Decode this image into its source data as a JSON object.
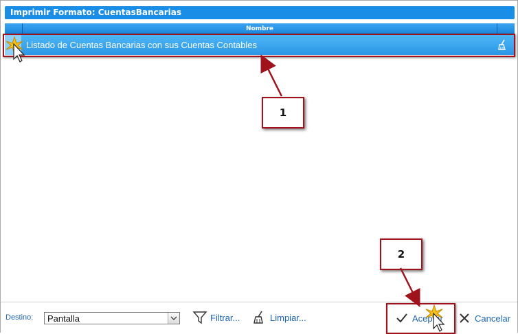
{
  "dialog": {
    "title": "Imprimir Formato: CuentasBancarias"
  },
  "grid": {
    "column_header": "Nombre",
    "rows": [
      {
        "name": "Listado de Cuentas Bancarias con sus Cuentas Contables"
      }
    ]
  },
  "callouts": {
    "first": "1",
    "second": "2"
  },
  "bottom_bar": {
    "destination_label": "Destino:",
    "destination_value": "Pantalla",
    "filter_label": "Filtrar...",
    "clear_label": "Limpiar...",
    "accept_label": "Aceptar",
    "cancel_label": "Cancelar"
  },
  "icons": {
    "filter": "funnel-icon",
    "clear": "broom-icon",
    "accept": "checkmark-icon",
    "cancel": "x-icon",
    "row_clear": "broom-icon"
  },
  "colors": {
    "titlebar": "#1a8ee6",
    "selected_row": "#2a96e6",
    "annotation": "#a0131c",
    "link": "#1d66b0"
  }
}
